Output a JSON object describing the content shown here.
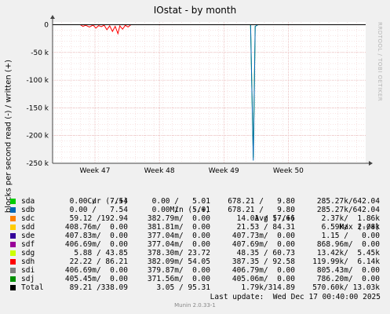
{
  "title": "IOstat - by month",
  "vendor": "RRDTOOL / TOBI OETIKER",
  "footer": "Munin 2.0.33-1",
  "last_update": "Last update:  Wed Dec 17 00:40:00 2025",
  "legend_headers": {
    "cur": "Cur (-/+)",
    "min": "Min (-/+)",
    "avg": "Avg (-/+)",
    "max": "Max (-/+)"
  },
  "legend": [
    {
      "name": "sda",
      "color": "#00cc00",
      "cur": "0.00 /   7.54",
      "min": "0.00 /   5.01",
      "avg": "678.21 /   9.80",
      "max": "285.27k/642.04"
    },
    {
      "name": "sdb",
      "color": "#0066b3",
      "cur": "0.00 /   7.54",
      "min": "0.00 /   5.01",
      "avg": "678.21 /   9.80",
      "max": "285.27k/642.04"
    },
    {
      "name": "sdc",
      "color": "#ff8000",
      "cur": "59.12 /192.94",
      "min": "382.79m/  0.00",
      "avg": "14.01 / 57.66",
      "max": "2.37k/  1.86k"
    },
    {
      "name": "sdd",
      "color": "#ffcc00",
      "cur": "408.76m/  0.00",
      "min": "381.81m/  0.00",
      "avg": "21.53 / 84.31",
      "max": "6.59k/  2.08k"
    },
    {
      "name": "sde",
      "color": "#330099",
      "cur": "407.83m/  0.00",
      "min": "377.04m/  0.00",
      "avg": "407.73m/  0.00",
      "max": "1.15 /   0.00"
    },
    {
      "name": "sdf",
      "color": "#990099",
      "cur": "406.69m/  0.00",
      "min": "377.04m/  0.00",
      "avg": "407.69m/  0.00",
      "max": "868.96m/  0.00"
    },
    {
      "name": "sdg",
      "color": "#ccff00",
      "cur": "5.88 / 43.85",
      "min": "378.30m/ 23.72",
      "avg": "48.35 / 60.73",
      "max": "13.42k/  5.45k"
    },
    {
      "name": "sdh",
      "color": "#ff0000",
      "cur": "22.22 / 86.21",
      "min": "382.09m/ 54.05",
      "avg": "387.35 / 92.58",
      "max": "119.99k/  6.14k"
    },
    {
      "name": "sdi",
      "color": "#808080",
      "cur": "406.69m/  0.00",
      "min": "379.87m/  0.00",
      "avg": "406.79m/  0.00",
      "max": "805.43m/  0.00"
    },
    {
      "name": "sdj",
      "color": "#008f00",
      "cur": "405.45m/  0.00",
      "min": "371.56m/  0.00",
      "avg": "405.06m/  0.00",
      "max": "786.20m/  0.00"
    },
    {
      "name": "Total",
      "color": "#000000",
      "cur": "89.21 /338.09",
      "min": "3.05 / 95.31",
      "avg": "1.79k/314.89",
      "max": "570.60k/ 13.03k"
    }
  ],
  "chart_data": {
    "type": "line",
    "title": "IOstat - by month",
    "ylabel": "blocks per second read (-) / written (+)",
    "ylim": [
      -250000,
      5000
    ],
    "yticks": [
      0,
      -50000,
      -100000,
      -150000,
      -200000,
      -250000
    ],
    "ytick_labels": [
      "0",
      "-50 k",
      "-100 k",
      "-150 k",
      "-200 k",
      "-250 k"
    ],
    "x_range_days": [
      0,
      34
    ],
    "xticks": [
      {
        "label": "Week 47",
        "day": 4.6
      },
      {
        "label": "Week 48",
        "day": 11.6
      },
      {
        "label": "Week 49",
        "day": 18.6
      },
      {
        "label": "Week 50",
        "day": 25.6
      }
    ],
    "grid": true,
    "series": [
      {
        "name": "sdh",
        "color": "#ff0000",
        "points": [
          [
            3.0,
            0
          ],
          [
            3.3,
            -3000
          ],
          [
            3.6,
            -1000
          ],
          [
            4.0,
            -4000
          ],
          [
            4.4,
            -500
          ],
          [
            4.7,
            -6000
          ],
          [
            5.0,
            -1500
          ],
          [
            5.3,
            -3500
          ],
          [
            5.6,
            -800
          ],
          [
            5.9,
            -9000
          ],
          [
            6.2,
            -2000
          ],
          [
            6.5,
            -12000
          ],
          [
            6.8,
            -3000
          ],
          [
            7.1,
            -16000
          ],
          [
            7.3,
            -2000
          ],
          [
            7.6,
            -8000
          ],
          [
            7.9,
            -1000
          ],
          [
            8.2,
            -4000
          ],
          [
            8.5,
            0
          ]
        ]
      },
      {
        "name": "sda",
        "color": "#00cc00",
        "points": [
          [
            0,
            0
          ],
          [
            21.5,
            0
          ],
          [
            21.8,
            -240000
          ],
          [
            22.0,
            -3000
          ],
          [
            22.3,
            0
          ],
          [
            34,
            0
          ]
        ]
      },
      {
        "name": "sdb",
        "color": "#0066b3",
        "points": [
          [
            0,
            0
          ],
          [
            21.5,
            0
          ],
          [
            21.8,
            -245000
          ],
          [
            22.0,
            -3000
          ],
          [
            22.3,
            0
          ],
          [
            34,
            0
          ]
        ]
      },
      {
        "name": "Total",
        "color": "#000000",
        "points": [
          [
            0,
            0
          ],
          [
            34,
            0
          ]
        ]
      }
    ]
  }
}
